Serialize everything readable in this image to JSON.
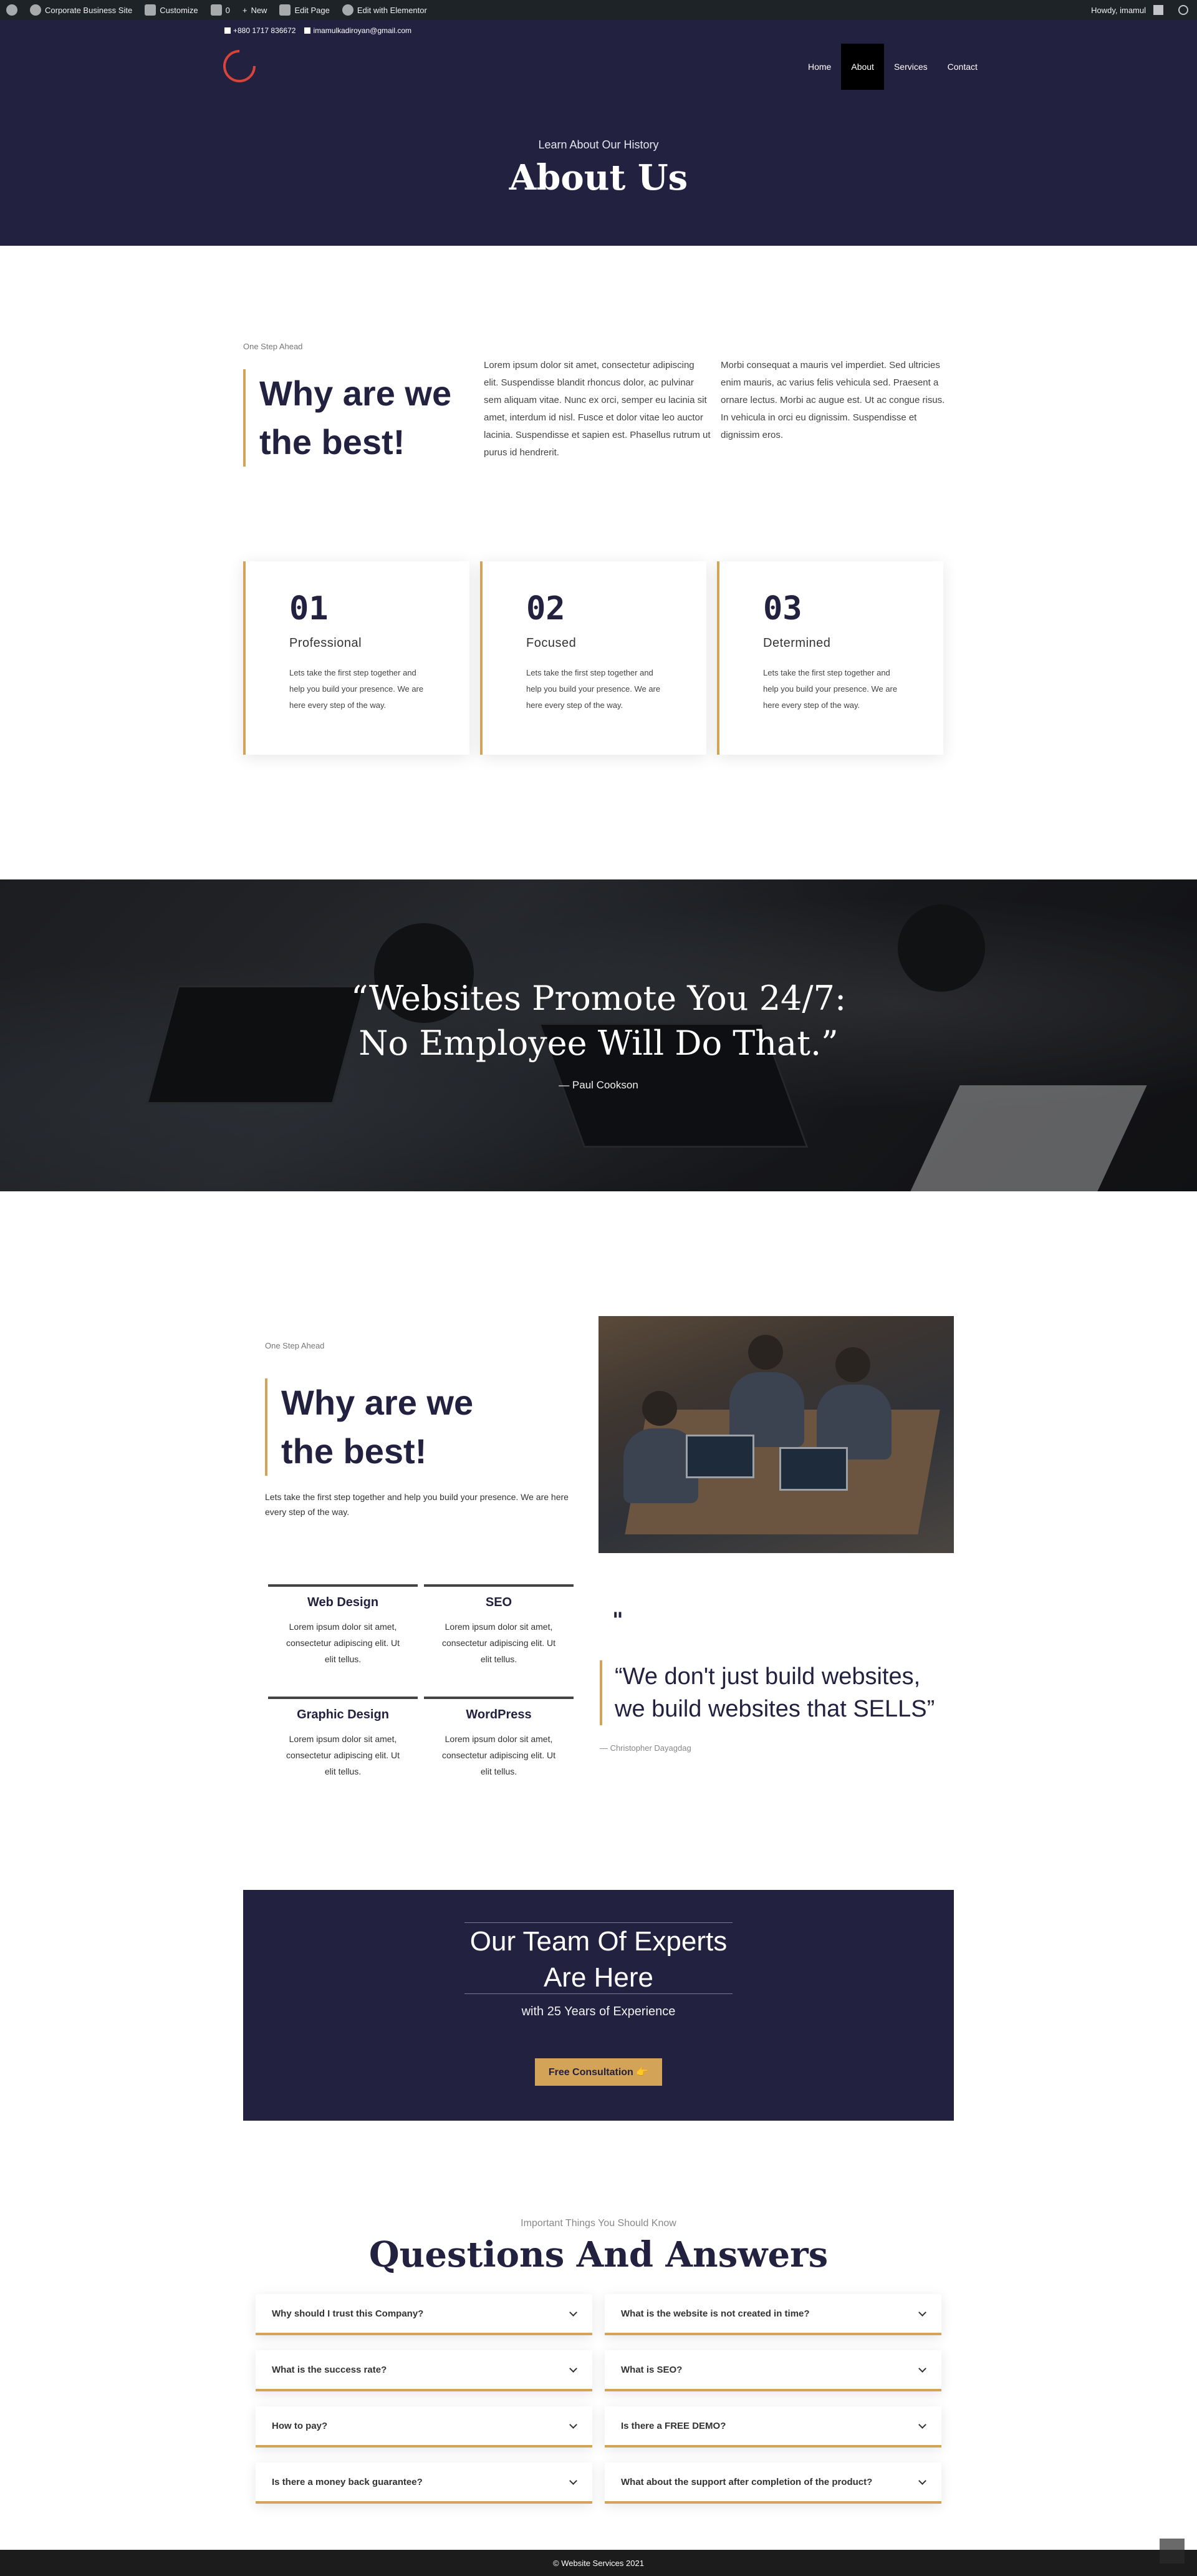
{
  "adminbar": {
    "site_name": "Corporate Business Site",
    "customize": "Customize",
    "comments": "0",
    "new": "New",
    "edit_page": "Edit Page",
    "elementor": "Edit with Elementor",
    "howdy": "Howdy, imamul"
  },
  "topbar": {
    "phone": "+880 1717 836672",
    "email": "imamulkadiroyan@gmail.com"
  },
  "nav": {
    "items": [
      "Home",
      "About",
      "Services",
      "Contact"
    ],
    "active": "About"
  },
  "hero": {
    "subtitle": "Learn About Our History",
    "title": "About Us"
  },
  "why1": {
    "eyebrow": "One Step Ahead",
    "title": "Why are we the best!",
    "para_a": "Lorem ipsum dolor sit amet, consectetur adipiscing elit. Suspendisse blandit rhoncus dolor, ac pulvinar sem aliquam vitae. Nunc ex orci, semper eu lacinia sit amet, interdum id nisl. Fusce et dolor vitae leo auctor lacinia. Suspendisse et sapien est. Phasellus rutrum ut purus id hendrerit.",
    "para_b": "Morbi consequat a mauris vel imperdiet. Sed ultricies enim mauris, ac varius felis vehicula sed. Praesent a ornare lectus. Morbi ac augue est. Ut ac congue risus. In vehicula in orci eu dignissim. Suspendisse et dignissim eros."
  },
  "cards": [
    {
      "num": "01",
      "title": "Professional",
      "text": "Lets take the first step together and help you build your presence. We are here every step of the way."
    },
    {
      "num": "02",
      "title": "Focused",
      "text": "Lets take the first step together and help you build your presence. We are here every step of the way."
    },
    {
      "num": "03",
      "title": "Determined",
      "text": "Lets take the first step together and help you build your presence. We are here every step of the way."
    }
  ],
  "banner": {
    "quote_line1": "“Websites Promote You 24/7:",
    "quote_line2": "No Employee Will Do That.”",
    "author": "— Paul Cookson"
  },
  "section2": {
    "eyebrow": "One Step Ahead",
    "title": "Why are we the best!",
    "text": "Lets take the first step together and help you build your presence. We are here every step of the way.",
    "services": [
      {
        "title": "Web Design",
        "text": "Lorem ipsum dolor sit amet, consectetur adipiscing elit. Ut elit tellus."
      },
      {
        "title": "SEO",
        "text": "Lorem ipsum dolor sit amet, consectetur adipiscing elit. Ut elit tellus."
      },
      {
        "title": "Graphic Design",
        "text": "Lorem ipsum dolor sit amet, consectetur adipiscing elit. Ut elit tellus."
      },
      {
        "title": "WordPress",
        "text": "Lorem ipsum dolor sit amet, consectetur adipiscing elit. Ut elit tellus."
      }
    ],
    "quote_mark": "\"",
    "quote": "“We don't just build websites, we build websites that SELLS”",
    "quote_author": "— Christopher Dayagdag"
  },
  "cta": {
    "title_line1": "Our Team Of Experts",
    "title_line2": "Are Here",
    "subtitle": "with 25 Years of Experience",
    "button": "Free Consultation 👉"
  },
  "faq": {
    "eyebrow": "Important Things You Should Know",
    "title": "Questions And Answers",
    "left": [
      "Why should I trust this Company?",
      "What is the success rate?",
      "How to pay?",
      "Is there a money back guarantee?"
    ],
    "right": [
      "What is the website is not created in time?",
      "What is SEO?",
      "Is there a FREE DEMO?",
      "What about the support after completion of the product?"
    ]
  },
  "footer": {
    "copyright": "© Website Services 2021"
  },
  "colors": {
    "navy": "#232140",
    "accent": "#d3a458",
    "logo": "#d9443a"
  }
}
